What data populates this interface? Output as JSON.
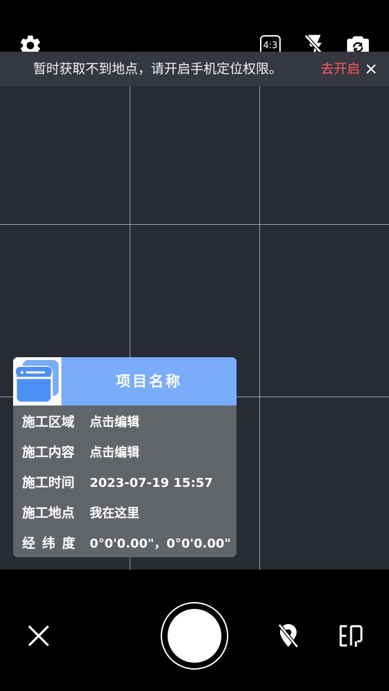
{
  "top_bar": {
    "settings_icon": "gear-icon",
    "ratio_label": "4:3",
    "flash_icon": "flash-off-icon",
    "switch_camera_icon": "switch-camera-icon"
  },
  "location_banner": {
    "message": "暂时获取不到地点，请开启手机定位权限。",
    "action_label": "去开启",
    "close_icon": "close-icon"
  },
  "watermark": {
    "title": "项目名称",
    "fields": [
      {
        "label": "施工区域",
        "value": "点击编辑"
      },
      {
        "label": "施工内容",
        "value": "点击编辑"
      },
      {
        "label": "施工时间",
        "value": "2023-07-19 15:57"
      },
      {
        "label": "施工地点",
        "value": "我在这里"
      },
      {
        "label": "经纬度",
        "value": "0°0'0.00\"，0°0'0.00\""
      }
    ],
    "header_color": "#7aacfc"
  },
  "bottom_bar": {
    "close_icon": "close-icon",
    "shutter_icon": "shutter-button",
    "location_icon": "location-off-icon",
    "watermark_icon": "watermark-icon"
  },
  "colors": {
    "accent_link": "#ff5a5a",
    "viewfinder_bg": "#272b34"
  }
}
